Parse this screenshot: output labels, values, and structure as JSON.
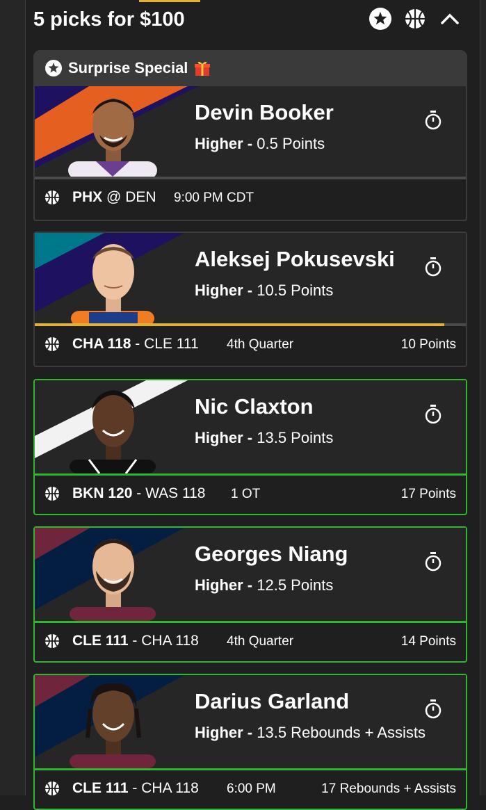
{
  "header": {
    "title": "5 picks for $100",
    "icons": [
      "star-icon",
      "basketball-icon",
      "chevron-up-icon"
    ]
  },
  "banner": {
    "label": "Surprise Special",
    "icons": [
      "star-icon",
      "gift-icon"
    ]
  },
  "colors": {
    "win_border": "#2eb82e",
    "accent_yellow": "#e2b22b",
    "card_border": "#3c3c3c",
    "suns_orange": "#e56020",
    "suns_purple": "#1d1160",
    "hornets_teal": "#00788c",
    "hornets_purple": "#1d1160",
    "nets_white": "#ffffff",
    "cavs_wine": "#6f263d",
    "cavs_navy": "#041e42"
  },
  "picks": [
    {
      "player": "Devin Booker",
      "direction": "Higher",
      "line": "0.5 Points",
      "team1": "PHX",
      "sep": "@",
      "team2": "DEN",
      "status": "9:00 PM CDT",
      "result": "",
      "progress": 0,
      "state": "pending"
    },
    {
      "player": "Aleksej Pokusevski",
      "direction": "Higher",
      "line": "10.5 Points",
      "team1": "CHA 118",
      "sep": "-",
      "team2": "CLE 111",
      "status": "4th Quarter",
      "result": "10 Points",
      "progress": 0.95,
      "state": "live"
    },
    {
      "player": "Nic Claxton",
      "direction": "Higher",
      "line": "13.5 Points",
      "team1": "BKN 120",
      "sep": "-",
      "team2": "WAS 118",
      "status": "1 OT",
      "result": "17 Points",
      "progress": 1,
      "state": "won"
    },
    {
      "player": "Georges Niang",
      "direction": "Higher",
      "line": "12.5 Points",
      "team1": "CLE 111",
      "sep": "-",
      "team2": "CHA 118",
      "status": "4th Quarter",
      "result": "14 Points",
      "progress": 1,
      "state": "won"
    },
    {
      "player": "Darius Garland",
      "direction": "Higher",
      "line": "13.5 Rebounds + Assists",
      "team1": "CLE 111",
      "sep": "-",
      "team2": "CHA 118",
      "status": "6:00 PM",
      "result": "17 Rebounds + Assists",
      "progress": 1,
      "state": "won"
    }
  ]
}
